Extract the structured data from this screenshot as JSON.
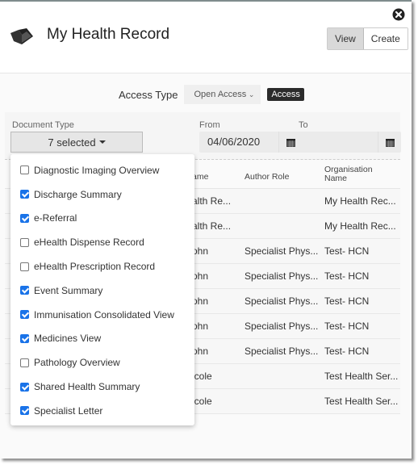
{
  "header": {
    "title": "My Health Record",
    "view_label": "View",
    "create_label": "Create",
    "close_icon": "close-circle-icon",
    "logo_icon": "my-health-record-logo"
  },
  "access": {
    "label": "Access Type",
    "selected": "Open Access",
    "button_label": "Access"
  },
  "filters": {
    "document_type_label": "Document Type",
    "document_type_value": "7 selected",
    "from_label": "From",
    "from_value": "04/06/2020",
    "to_label": "To",
    "to_value": ""
  },
  "table": {
    "headers": [
      "ame",
      "Author Role",
      "Organisation Name"
    ],
    "rows": [
      {
        "name": "alth Re...",
        "role": "",
        "org": "My Health Rec..."
      },
      {
        "name": "alth Re...",
        "role": "",
        "org": "My Health Rec..."
      },
      {
        "name": "ohn",
        "role": "Specialist Phys...",
        "org": "Test- HCN"
      },
      {
        "name": "ohn",
        "role": "Specialist Phys...",
        "org": "Test- HCN"
      },
      {
        "name": "ohn",
        "role": "Specialist Phys...",
        "org": "Test- HCN"
      },
      {
        "name": "ohn",
        "role": "Specialist Phys...",
        "org": "Test- HCN"
      },
      {
        "name": "ohn",
        "role": "Specialist Phys...",
        "org": "Test- HCN"
      },
      {
        "name": "icole",
        "role": "",
        "org": "Test Health Ser..."
      },
      {
        "name": "icole",
        "role": "",
        "org": "Test Health Ser..."
      }
    ]
  },
  "dropdown": {
    "options": [
      {
        "label": "Diagnostic Imaging Overview",
        "checked": false
      },
      {
        "label": "Discharge Summary",
        "checked": true
      },
      {
        "label": "e-Referral",
        "checked": true
      },
      {
        "label": "eHealth Dispense Record",
        "checked": false
      },
      {
        "label": "eHealth Prescription Record",
        "checked": false
      },
      {
        "label": "Event Summary",
        "checked": true
      },
      {
        "label": "Immunisation Consolidated View",
        "checked": true
      },
      {
        "label": "Medicines View",
        "checked": true
      },
      {
        "label": "Pathology Overview",
        "checked": false
      },
      {
        "label": "Shared Health Summary",
        "checked": true
      },
      {
        "label": "Specialist Letter",
        "checked": true
      }
    ]
  },
  "colors": {
    "checkbox_checked": "#1a73e8",
    "access_button": "#2b2b2b",
    "active_segment": "#d9d9d9"
  }
}
